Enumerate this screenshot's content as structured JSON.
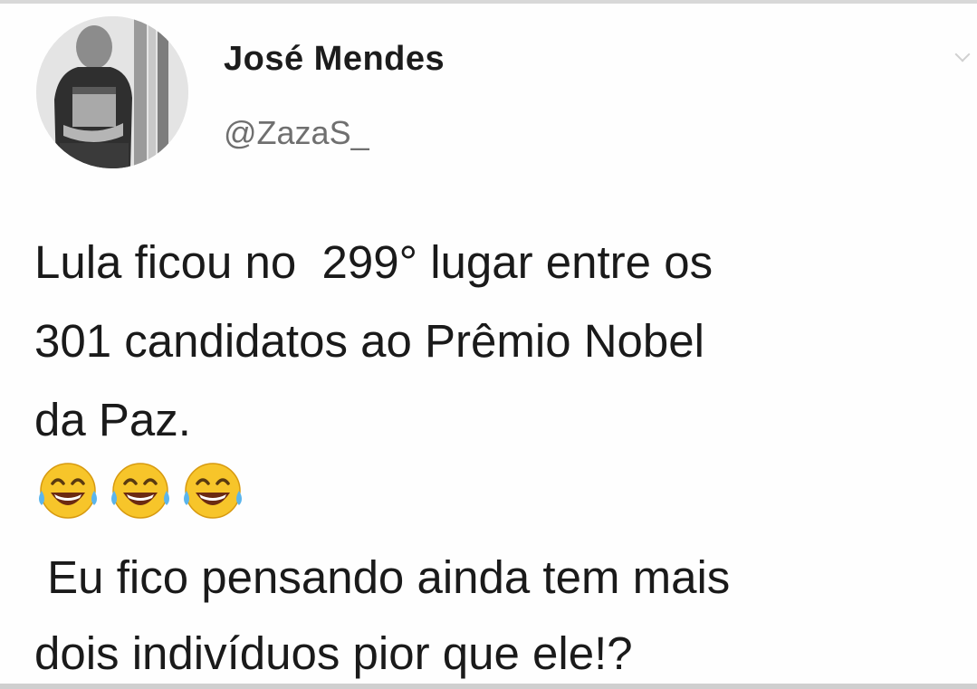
{
  "tweet": {
    "author": {
      "display_name": "José  Mendes",
      "handle": "@ZazaS_",
      "avatar_icon": "user-photo-avatar"
    },
    "text_lines": [
      "Lula ficou no  299° lugar entre os",
      "301 candidatos ao Prêmio Nobel",
      "da Paz."
    ],
    "emojis": [
      "😂",
      "😂",
      "😂"
    ],
    "followup_lines": [
      " Eu fico pensando ainda tem mais",
      "dois indivíduos pior que ele!?"
    ]
  },
  "colors": {
    "text": "#1a1a1a",
    "handle": "#6f6f6f",
    "background": "#ffffff"
  }
}
